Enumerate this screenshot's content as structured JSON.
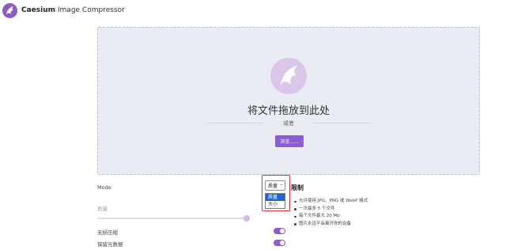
{
  "app": {
    "brand_bold": "Caesium",
    "brand_rest": " Image Compressor"
  },
  "dropzone": {
    "title": "将文件拖放到此处",
    "or_text": "或者",
    "browse_label": "浏览......"
  },
  "settings": {
    "mode_label": "Mode",
    "mode_value": "质量",
    "mode_options": [
      "质量",
      "大小"
    ],
    "mode_selected_index": 0,
    "quality_label": "质量",
    "lossless_label": "无损压缩",
    "lossless_on": true,
    "keep_metadata_label": "保留元数据",
    "keep_metadata_on": true
  },
  "limits": {
    "title": "限制",
    "items": [
      "允许使用 JPG、PNG 或 WebP 格式",
      "一次最多 5 个文件",
      "每个文件最大 20 Mb",
      "图片永远不会离开你的设备"
    ]
  },
  "colors": {
    "accent": "#8e5bd6",
    "highlight": "#e0333a",
    "dropzone_bg": "#e9edf3"
  }
}
